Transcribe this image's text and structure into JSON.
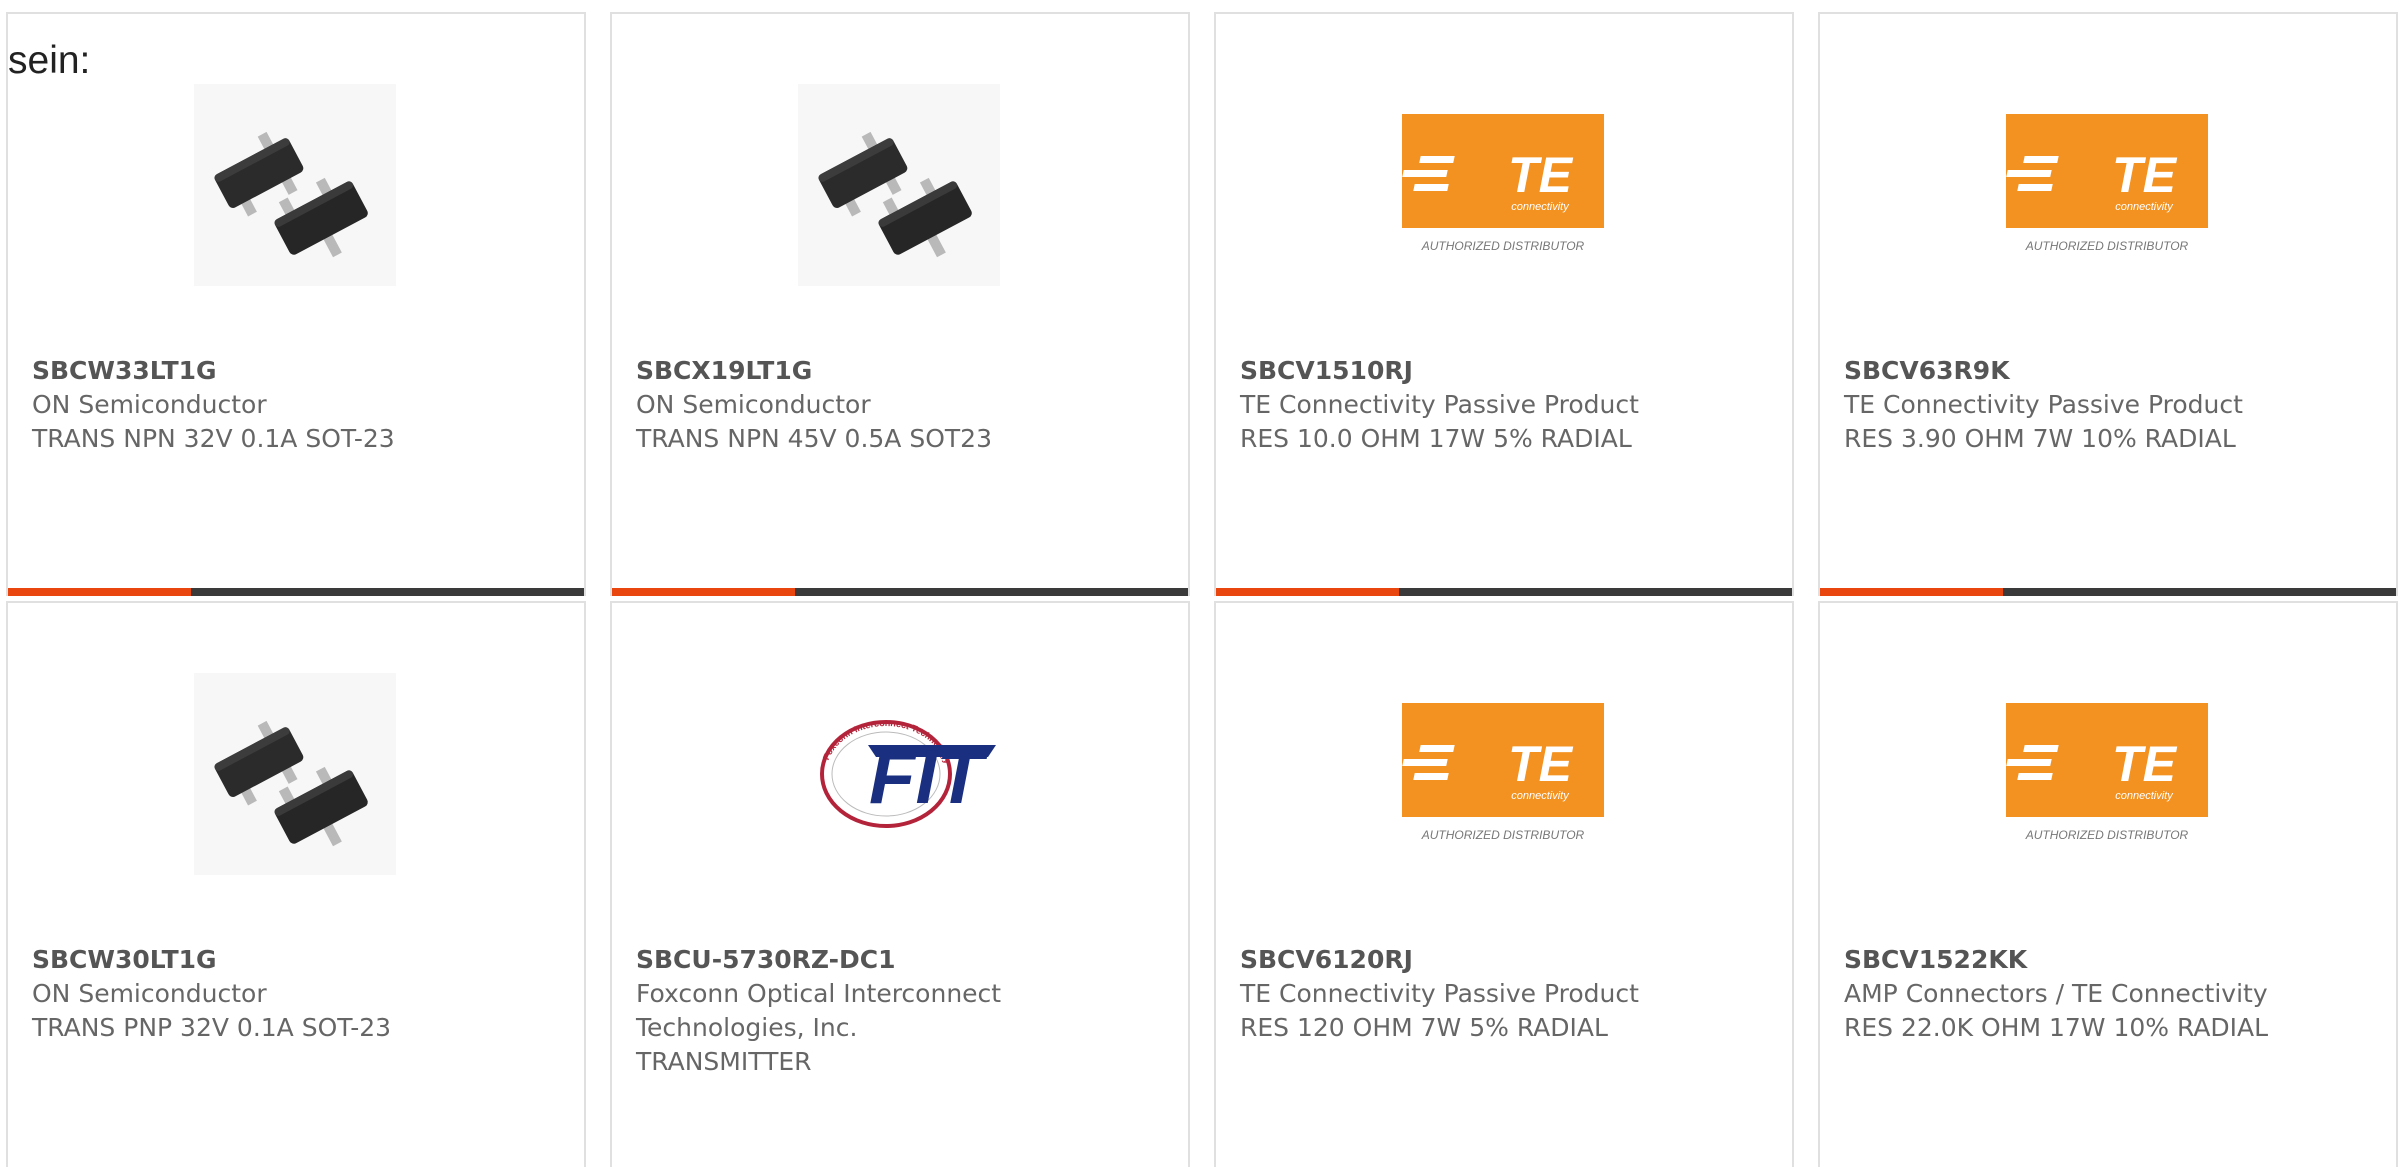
{
  "intro_text": "sein:",
  "colors": {
    "accent": "#e8450f",
    "bar_dark": "#3a3a3a",
    "te_orange": "#f39220",
    "fit_blue": "#1a2f80",
    "fit_red": "#b3243a"
  },
  "products": [
    {
      "part_number": "SBCW33LT1G",
      "manufacturer": "ON Semiconductor",
      "description": "TRANS NPN 32V 0.1A SOT-23",
      "image": "sot23-transistor-icon"
    },
    {
      "part_number": "SBCX19LT1G",
      "manufacturer": "ON Semiconductor",
      "description": "TRANS NPN 45V 0.5A SOT23",
      "image": "sot23-transistor-icon"
    },
    {
      "part_number": "SBCV1510RJ",
      "manufacturer": "TE Connectivity Passive Product",
      "description": "RES 10.0 OHM 17W 5% RADIAL",
      "image": "te-connectivity-logo",
      "logo_text": "TE",
      "logo_subtext": "connectivity",
      "logo_caption": "AUTHORIZED DISTRIBUTOR"
    },
    {
      "part_number": "SBCV63R9K",
      "manufacturer": "TE Connectivity Passive Product",
      "description": "RES 3.90 OHM 7W 10% RADIAL",
      "image": "te-connectivity-logo",
      "logo_text": "TE",
      "logo_subtext": "connectivity",
      "logo_caption": "AUTHORIZED DISTRIBUTOR"
    },
    {
      "part_number": "SBCW30LT1G",
      "manufacturer": "ON Semiconductor",
      "description": "TRANS PNP 32V 0.1A SOT-23",
      "image": "sot23-transistor-icon"
    },
    {
      "part_number": "SBCU-5730RZ-DC1",
      "manufacturer": "Foxconn Optical Interconnect Technologies, Inc.",
      "description": "TRANSMITTER",
      "image": "fit-logo",
      "logo_text": "FIT",
      "logo_ring_text": "Foxconn Interconnect Technology"
    },
    {
      "part_number": "SBCV6120RJ",
      "manufacturer": "TE Connectivity Passive Product",
      "description": "RES 120 OHM 7W 5% RADIAL",
      "image": "te-connectivity-logo",
      "logo_text": "TE",
      "logo_subtext": "connectivity",
      "logo_caption": "AUTHORIZED DISTRIBUTOR"
    },
    {
      "part_number": "SBCV1522KK",
      "manufacturer": "AMP Connectors / TE Connectivity",
      "description": "RES 22.0K OHM 17W 10% RADIAL",
      "image": "te-connectivity-logo",
      "logo_text": "TE",
      "logo_subtext": "connectivity",
      "logo_caption": "AUTHORIZED DISTRIBUTOR"
    }
  ]
}
